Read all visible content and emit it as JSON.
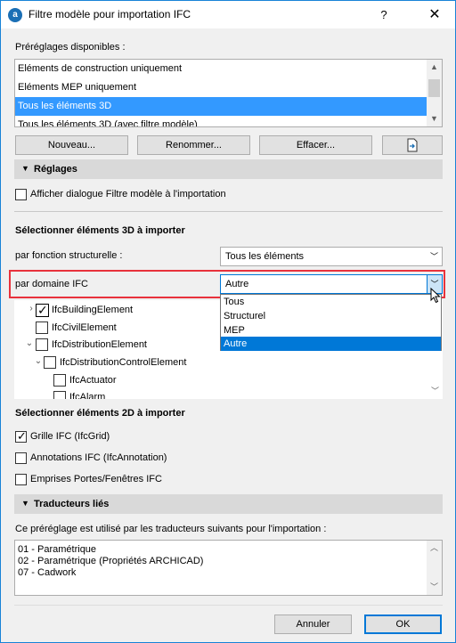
{
  "window": {
    "title": "Filtre modèle pour importation IFC",
    "help": "?",
    "close": "✕"
  },
  "presets": {
    "label": "Préréglages disponibles :",
    "items": [
      "Eléments de construction uniquement",
      "Eléments MEP uniquement",
      "Tous les éléments 3D",
      "Tous les éléments 3D (avec filtre modèle)"
    ],
    "selected": "Tous les éléments 3D",
    "buttons": {
      "new": "Nouveau...",
      "rename": "Renommer...",
      "delete": "Effacer..."
    }
  },
  "settings": {
    "header": "Réglages",
    "show_dialog": "Afficher dialogue Filtre modèle à l'importation"
  },
  "select3d": {
    "label": "Sélectionner éléments 3D à importer",
    "structural_label": "par fonction structurelle :",
    "structural_value": "Tous les éléments",
    "domain_label": "par domaine IFC",
    "domain_value": "Autre",
    "domain_options": [
      "Tous",
      "Structurel",
      "MEP",
      "Autre"
    ]
  },
  "tree": [
    {
      "label": "IfcBuildingElement",
      "checked": true
    },
    {
      "label": "IfcCivilElement",
      "checked": false
    },
    {
      "label": "IfcDistributionElement",
      "checked": false
    },
    {
      "label": "IfcDistributionControlElement",
      "checked": false
    },
    {
      "label": "IfcActuator",
      "checked": false
    },
    {
      "label": "IfcAlarm",
      "checked": false
    }
  ],
  "select2d": {
    "label": "Sélectionner éléments 2D à importer",
    "grid": "Grille IFC (IfcGrid)",
    "annotations": "Annotations IFC (IfcAnnotation)",
    "openings": "Emprises Portes/Fenêtres IFC"
  },
  "translators": {
    "header": "Traducteurs liés",
    "description": "Ce préréglage est utilisé par les traducteurs suivants pour l'importation :",
    "items": [
      "01 - Paramétrique",
      "02 - Paramétrique (Propriétés ARCHICAD)",
      "07 - Cadwork"
    ]
  },
  "footer": {
    "cancel": "Annuler",
    "ok": "OK"
  },
  "colors": {
    "selection": "#3399ff",
    "highlight": "#e8323c",
    "accent": "#0078d7"
  }
}
